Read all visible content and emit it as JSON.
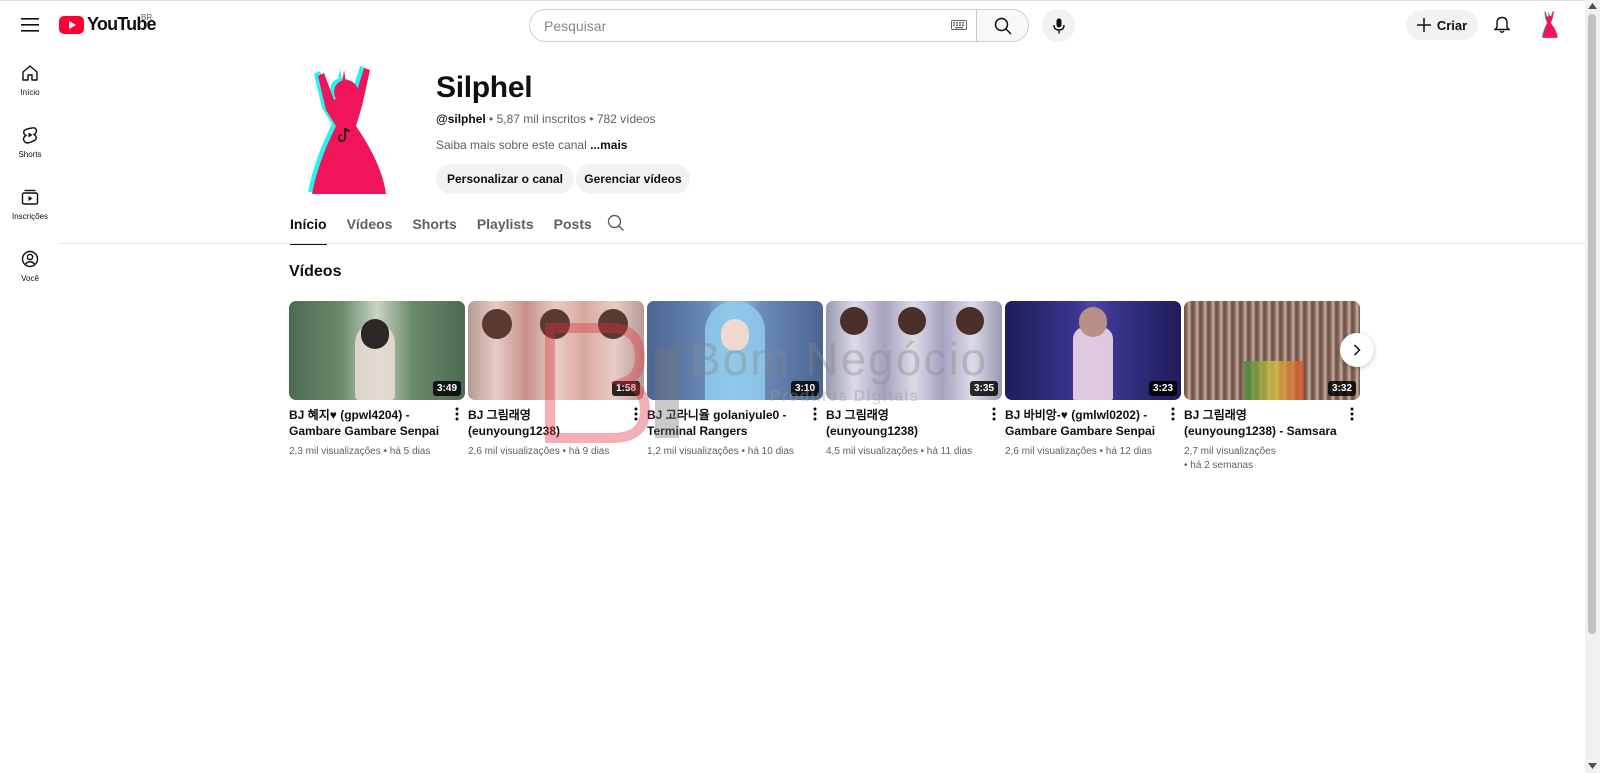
{
  "header": {
    "logo_text": "YouTube",
    "region": "BR",
    "search_placeholder": "Pesquisar",
    "create_label": "Criar"
  },
  "leftnav": [
    {
      "label": "Início",
      "icon": "home-icon"
    },
    {
      "label": "Shorts",
      "icon": "shorts-icon"
    },
    {
      "label": "Inscrições",
      "icon": "subscriptions-icon"
    },
    {
      "label": "Você",
      "icon": "you-icon"
    }
  ],
  "channel": {
    "name": "Silphel",
    "handle": "@silphel",
    "meta_rest": " • 5,87 mil inscritos • 782 vídeos",
    "desc": "Saiba mais sobre este canal ",
    "more": "...mais",
    "customize_label": "Personalizar o canal",
    "manage_label": "Gerenciar vídeos"
  },
  "tabs": [
    "Início",
    "Vídeos",
    "Shorts",
    "Playlists",
    "Posts"
  ],
  "section_title": "Vídeos",
  "videos": [
    {
      "title": "BJ 혜지♥ (gpwl4204) - Gambare Gambare Senpai",
      "meta": "2,3 mil visualizações • há 5 dias",
      "duration": "3:49",
      "bg": "#5a7a5e"
    },
    {
      "title": "BJ 그림래영 (eunyoung1238)",
      "meta": "2,6 mil visualizações • há 9 dias",
      "duration": "1:58",
      "bg": "#c9a7a0"
    },
    {
      "title": "BJ 고라니율 golaniyule0 - Terminal Rangers",
      "meta": "1,2 mil visualizações • há 10 dias",
      "duration": "3:10",
      "bg": "#5f7fa8"
    },
    {
      "title": "BJ 그림래영 (eunyoung1238)",
      "meta": "4,5 mil visualizações • há 11 dias",
      "duration": "3:35",
      "bg": "#b8b8c8"
    },
    {
      "title": "BJ 바비앙-♥ (gmlwl0202) - Gambare Gambare Senpai",
      "meta": "2,6 mil visualizações • há 12 dias",
      "duration": "3:23",
      "bg": "#2c2a6e"
    },
    {
      "title": "BJ 그림래영 (eunyoung1238) - Samsara",
      "meta": "2,7 mil visualizações\n • há 2 semanas",
      "duration": "3:32",
      "bg": "#7a5a50"
    }
  ],
  "watermark": {
    "line1": "Bom Negócio",
    "line2": "Produtos Digitais"
  },
  "colors": {
    "brand_red": "#ff0033",
    "avatar_pink": "#f0145a",
    "avatar_cyan": "#25f4ee"
  }
}
